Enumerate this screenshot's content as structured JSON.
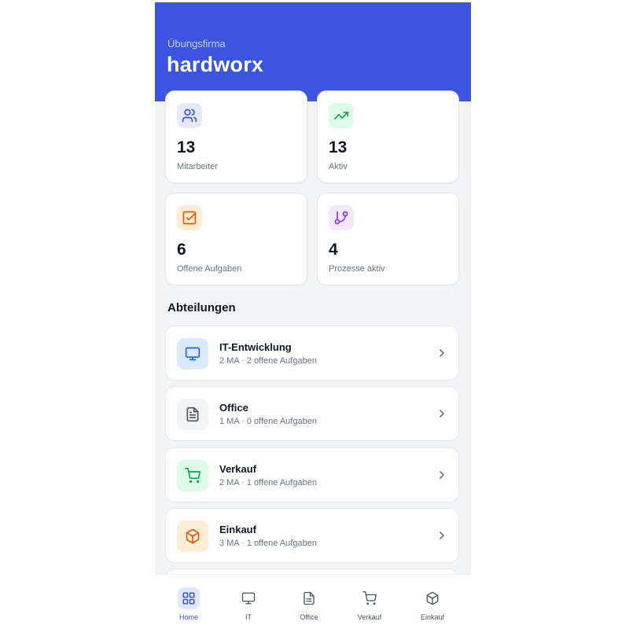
{
  "header": {
    "subtitle": "Übungsfirma",
    "title": "hardworx"
  },
  "stats": [
    {
      "value": "13",
      "label": "Mitarbeiter",
      "icon": "users-icon"
    },
    {
      "value": "13",
      "label": "Aktiv",
      "icon": "trending-up-icon"
    },
    {
      "value": "6",
      "label": "Offene Aufgaben",
      "icon": "check-square-icon"
    },
    {
      "value": "4",
      "label": "Prozesse aktiv",
      "icon": "git-branch-icon"
    }
  ],
  "departments": {
    "title": "Abteilungen",
    "items": [
      {
        "name": "IT-Entwicklung",
        "meta": "2 MA · 2 offene Aufgaben",
        "icon": "monitor-icon"
      },
      {
        "name": "Office",
        "meta": "1 MA · 0 offene Aufgaben",
        "icon": "file-text-icon"
      },
      {
        "name": "Verkauf",
        "meta": "2 MA · 1 offene Aufgaben",
        "icon": "shopping-cart-icon"
      },
      {
        "name": "Einkauf",
        "meta": "3 MA · 1 offene Aufgaben",
        "icon": "package-icon"
      }
    ]
  },
  "nav": {
    "items": [
      {
        "label": "Home",
        "icon": "grid-icon",
        "active": true
      },
      {
        "label": "IT",
        "icon": "monitor-icon"
      },
      {
        "label": "Office",
        "icon": "file-text-icon"
      },
      {
        "label": "Verkauf",
        "icon": "shopping-cart-icon"
      },
      {
        "label": "Einkauf",
        "icon": "package-icon"
      }
    ]
  },
  "colors": {
    "primary": "#3b55e0",
    "background": "#f3f4f6",
    "card": "#ffffff",
    "green": "#16a34a",
    "orange": "#ea580c",
    "purple": "#9333ea"
  }
}
